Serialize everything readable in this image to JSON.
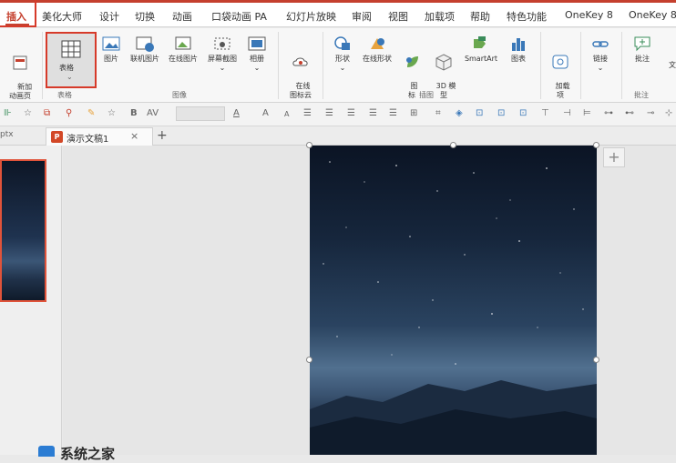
{
  "menu": {
    "tabs": [
      "插入",
      "美化大师",
      "设计",
      "切换",
      "动画",
      "口袋动画 PA",
      "幻灯片放映",
      "审阅",
      "视图",
      "加载项",
      "帮助",
      "特色功能",
      "OneKey 8",
      "OneKey 8"
    ]
  },
  "ribbon": {
    "new_page": "新加\n动画页",
    "table": "表格",
    "table_group": "表格",
    "picture": "图片",
    "online_pics": "联机图片",
    "online_pic2": "在线图片",
    "screenshot": "屏幕截图",
    "album": "相册",
    "images_group": "图像",
    "online_icons": "在线\n图标云",
    "shapes": "形状",
    "online_shapes": "在线形状",
    "icons": "图\n标",
    "model3d": "3D 模\n型",
    "smartart": "SmartArt",
    "chart": "图表",
    "illustration_group": "插图",
    "addin": "加载\n项",
    "link": "链接",
    "comment": "批注",
    "comment_group": "批注",
    "text_label": "文"
  },
  "format_bar": {
    "bold": "B",
    "kern": "AV",
    "font_color": "A",
    "grow": "A",
    "shrink": "A"
  },
  "doc_tabs": {
    "prev_tab": "ptx",
    "active_tab": "演示文稿1",
    "close": "×",
    "add": "+"
  },
  "canvas": {
    "add_button": "+"
  },
  "bottom_text": "系统之家"
}
